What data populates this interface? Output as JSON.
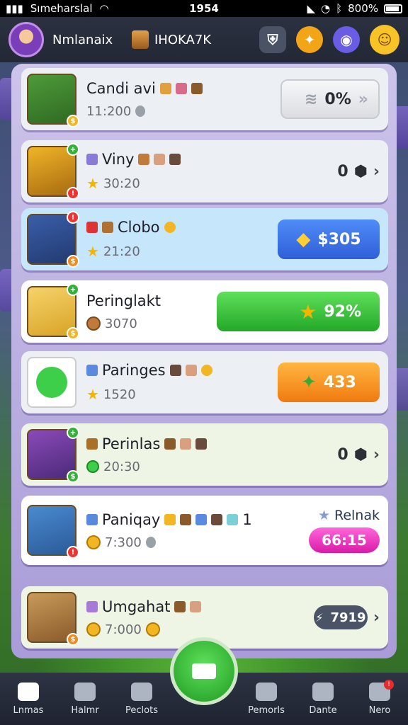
{
  "status_bar": {
    "carrier": "Sımeharslal",
    "time": "1954",
    "battery": "800%"
  },
  "header": {
    "player_name": "Nmlanaix",
    "guild_name": "IHOKA7K"
  },
  "cards": [
    {
      "title": "Candi avi",
      "subtitle": "11:200",
      "action": "0%",
      "style": "grey"
    },
    {
      "title": "Viny",
      "subtitle": "30:20",
      "action": "0",
      "style": "plain"
    },
    {
      "title": "Clobo",
      "subtitle": "21:20",
      "action": "$305",
      "style": "blue"
    },
    {
      "title": "Peringlakt",
      "subtitle": "3070",
      "action": "92%",
      "style": "green"
    },
    {
      "title": "Paringes",
      "subtitle": "1520",
      "action": "433",
      "style": "orange"
    },
    {
      "title": "Perinlas",
      "subtitle": "20:30",
      "action": "0",
      "style": "plain"
    },
    {
      "title": "Paniqay",
      "title_suffix": "1",
      "subtitle": "7:300",
      "action_label": "Relnak",
      "action": "66:15",
      "style": "pink"
    },
    {
      "title": "Umgahat",
      "subtitle": "7:000",
      "action": "7919",
      "style": "dark"
    }
  ],
  "nav": {
    "items": [
      "Lnmas",
      "Halmr",
      "Peclots",
      "Pemorls",
      "Dante",
      "Nero"
    ]
  },
  "colors": {
    "accent_green": "#23a828",
    "accent_blue": "#2f5fd8",
    "accent_orange": "#f07a10",
    "accent_pink": "#d81ba8",
    "panel": "#a99cd8"
  }
}
